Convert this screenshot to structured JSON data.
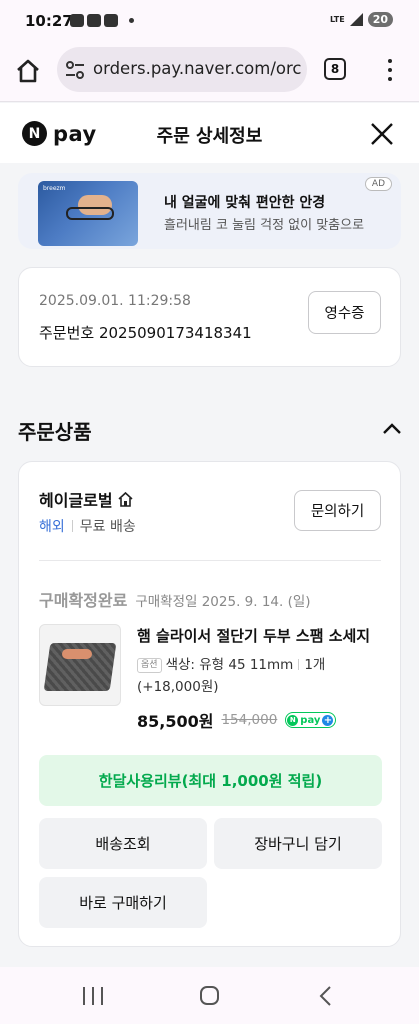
{
  "status_bar": {
    "time": "10:27",
    "notif_icons": [
      "talk-icon",
      "voicemail-icon",
      "app-icon"
    ],
    "network": "LTE",
    "battery": "20"
  },
  "browser": {
    "url": "orders.pay.naver.com/orc",
    "tab_count": "8"
  },
  "header": {
    "logo_circle": "N",
    "logo_word": "pay",
    "title": "주문 상세정보"
  },
  "ad": {
    "title": "내 얼굴에 맞춰 편안한 안경",
    "subtitle": "흘러내림 코 눌림 걱정 없이 맞춤으로",
    "badge": "AD",
    "image_brand": "breezm"
  },
  "order": {
    "date": "2025.09.01. 11:29:58",
    "number": "주문번호 2025090173418341",
    "receipt_label": "영수증"
  },
  "section": {
    "title": "주문상품"
  },
  "seller": {
    "name": "헤이글로벌",
    "origin": "해외",
    "shipping": "무료 배송",
    "inquiry_label": "문의하기"
  },
  "product": {
    "status": "구매확정완료",
    "confirm_date": "구매확정일 2025. 9. 14. (일)",
    "name": "햄 슬라이서 절단기 두부 스팸 소세지",
    "option_badge": "옵션",
    "option": "색상: 유형 45 11mm",
    "quantity": "1개 (+18,000원)",
    "price": "85,500원",
    "original_price": "154,000",
    "npay_n": "N",
    "npay_word": "pay",
    "npay_plus": "+"
  },
  "actions": {
    "review": "한달사용리뷰(최대 1,000원 적립)",
    "tracking": "배송조회",
    "cart": "장바구니 담기",
    "buy_now": "바로 구매하기"
  },
  "colors": {
    "naver_green": "#03c75a",
    "review_bg": "#e3f8e8",
    "overseas_blue": "#3a71d8"
  }
}
